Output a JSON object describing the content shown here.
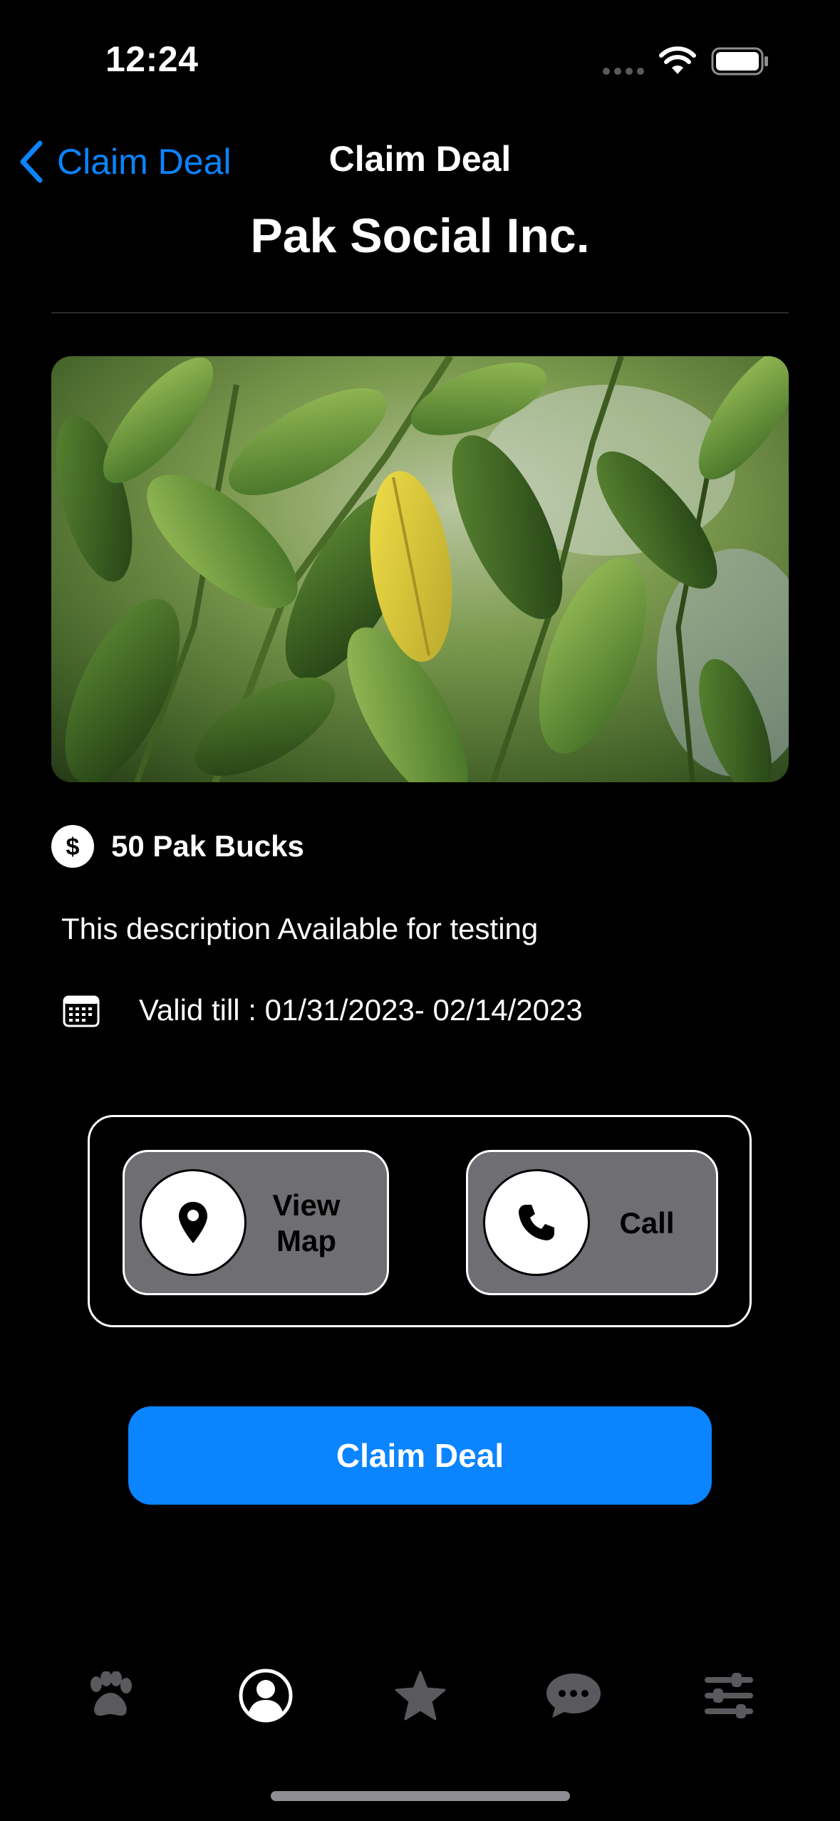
{
  "status_bar": {
    "time": "12:24"
  },
  "nav": {
    "back_label": "Claim Deal",
    "title": "Claim Deal"
  },
  "deal": {
    "business_name": "Pak Social Inc.",
    "image_subject": "green-leaves-photo",
    "bucks": "50 Pak Bucks",
    "description": "This description Available for testing",
    "valid": "Valid till : 01/31/2023- 02/14/2023"
  },
  "actions": {
    "view_map_line1": "View",
    "view_map_line2": "Map",
    "call_label": "Call"
  },
  "claim_button_label": "Claim Deal",
  "tab_bar": {
    "tabs": [
      {
        "icon": "paw-icon",
        "active": false
      },
      {
        "icon": "profile-icon",
        "active": true
      },
      {
        "icon": "star-icon",
        "active": false
      },
      {
        "icon": "chat-icon",
        "active": false
      },
      {
        "icon": "sliders-icon",
        "active": false
      }
    ]
  },
  "colors": {
    "accent": "#0a84ff",
    "background": "#000000",
    "action_button": "#6e6e73",
    "tab_active": "#ffffff",
    "tab_inactive": "#5a5a5e"
  }
}
